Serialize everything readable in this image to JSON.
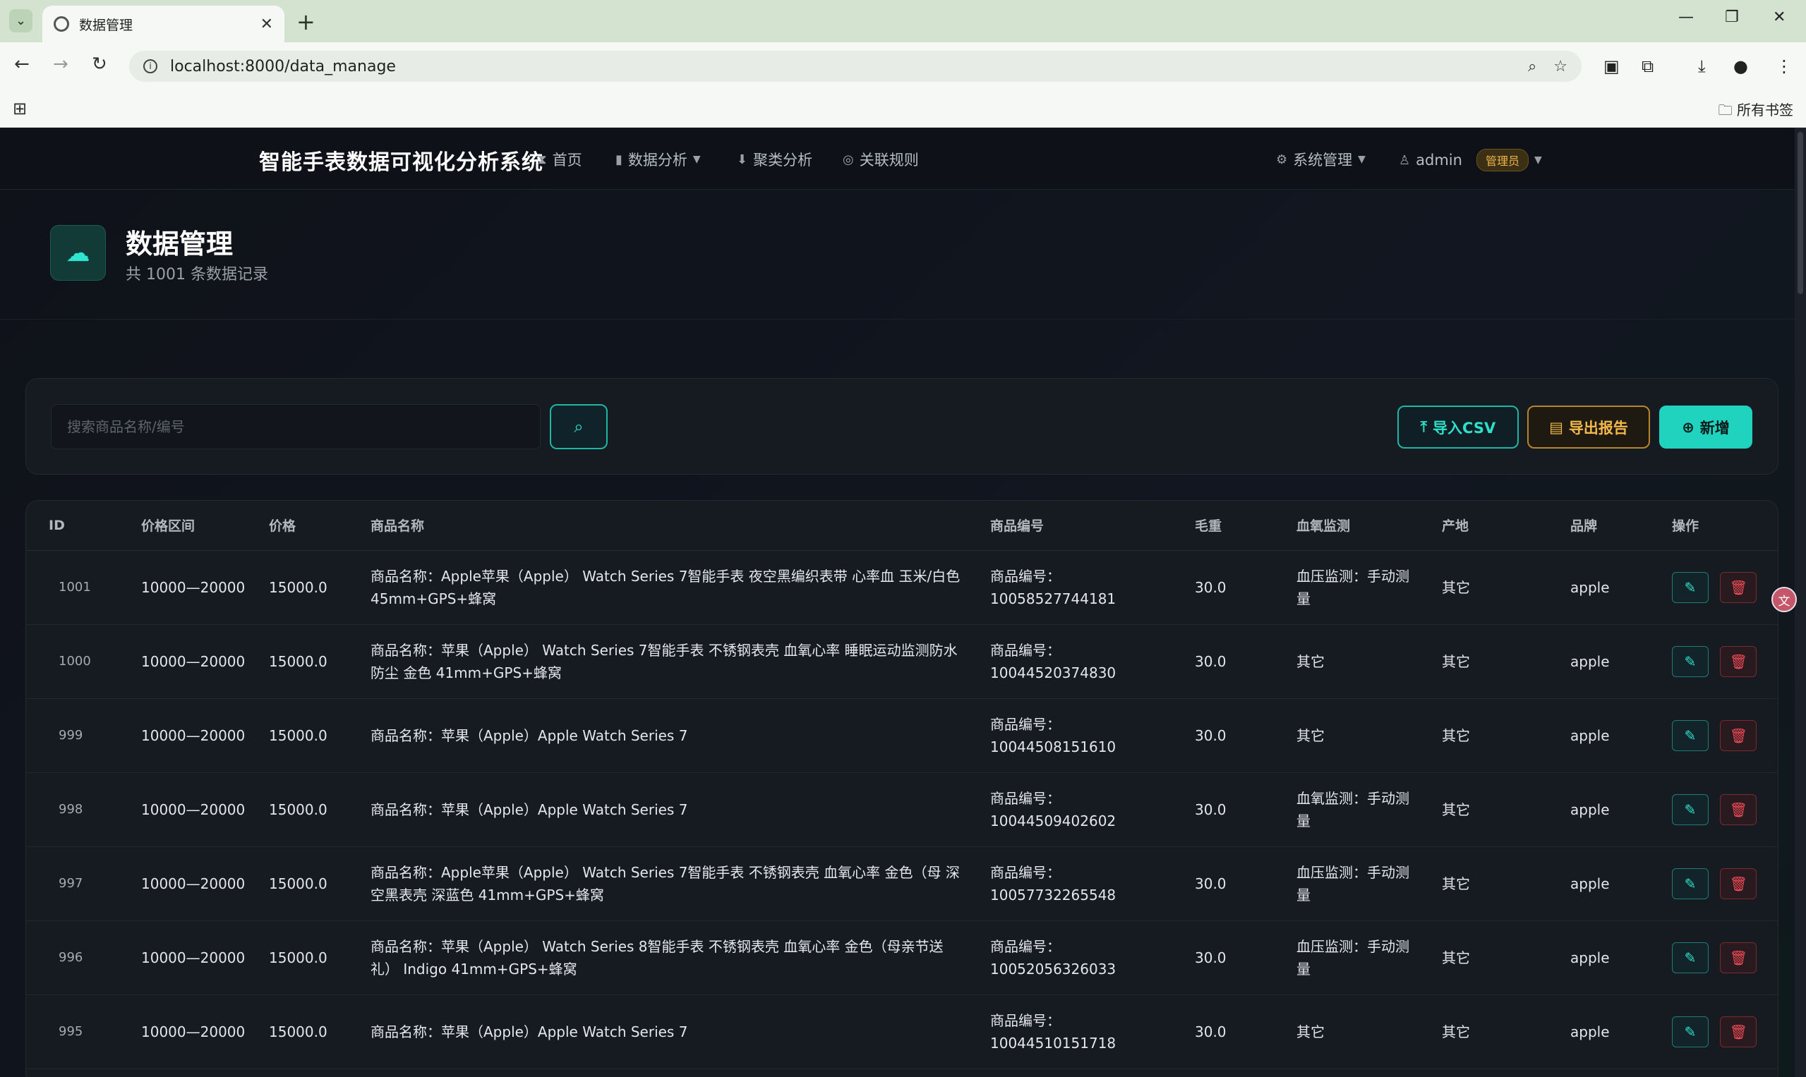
{
  "browser": {
    "tab_title": "数据管理",
    "url": "localhost:8000/data_manage",
    "bookmarks_label": "所有书签"
  },
  "nav": {
    "brand": "智能手表数据可视化分析系统",
    "home": "首页",
    "data_analysis": "数据分析",
    "cluster_analysis": "聚类分析",
    "association_rules": "关联规则",
    "system_management": "系统管理",
    "user": "admin",
    "role": "管理员"
  },
  "header": {
    "title": "数据管理",
    "subtitle": "共 1001 条数据记录"
  },
  "toolbar": {
    "search_placeholder": "搜索商品名称/编号",
    "import_label": "导入CSV",
    "export_label": "导出报告",
    "add_label": "新增"
  },
  "table": {
    "headers": [
      "ID",
      "价格区间",
      "价格",
      "商品名称",
      "商品编号",
      "毛重",
      "血氧监测",
      "产地",
      "品牌",
      "操作"
    ],
    "rows": [
      {
        "id": "1001",
        "range": "10000—20000",
        "price": "15000.0",
        "name": "商品名称：Apple苹果（Apple） Watch Series 7智能手表 夜空黑编织表带 心率血 玉米/白色 45mm+GPS+蜂窝",
        "code": "商品编号：10058527744181",
        "weight": "30.0",
        "oxygen": "血压监测：手动测量",
        "origin": "其它",
        "brand": "apple"
      },
      {
        "id": "1000",
        "range": "10000—20000",
        "price": "15000.0",
        "name": "商品名称：苹果（Apple） Watch Series 7智能手表 不锈钢表壳 血氧心率 睡眠运动监测防水防尘 金色 41mm+GPS+蜂窝",
        "code": "商品编号：10044520374830",
        "weight": "30.0",
        "oxygen": "其它",
        "origin": "其它",
        "brand": "apple"
      },
      {
        "id": "999",
        "range": "10000—20000",
        "price": "15000.0",
        "name": "商品名称：苹果（Apple）Apple Watch Series 7",
        "code": "商品编号：10044508151610",
        "weight": "30.0",
        "oxygen": "其它",
        "origin": "其它",
        "brand": "apple"
      },
      {
        "id": "998",
        "range": "10000—20000",
        "price": "15000.0",
        "name": "商品名称：苹果（Apple）Apple Watch Series 7",
        "code": "商品编号：10044509402602",
        "weight": "30.0",
        "oxygen": "血氧监测：手动测量",
        "origin": "其它",
        "brand": "apple"
      },
      {
        "id": "997",
        "range": "10000—20000",
        "price": "15000.0",
        "name": "商品名称：Apple苹果（Apple） Watch Series 7智能手表 不锈钢表壳 血氧心率 金色（母 深空黑表壳 深蓝色 41mm+GPS+蜂窝",
        "code": "商品编号：10057732265548",
        "weight": "30.0",
        "oxygen": "血压监测：手动测量",
        "origin": "其它",
        "brand": "apple"
      },
      {
        "id": "996",
        "range": "10000—20000",
        "price": "15000.0",
        "name": "商品名称：苹果（Apple） Watch Series 8智能手表 不锈钢表壳 血氧心率 金色（母亲节送礼） Indigo 41mm+GPS+蜂窝",
        "code": "商品编号：10052056326033",
        "weight": "30.0",
        "oxygen": "血压监测：手动测量",
        "origin": "其它",
        "brand": "apple"
      },
      {
        "id": "995",
        "range": "10000—20000",
        "price": "15000.0",
        "name": "商品名称：苹果（Apple）Apple Watch Series 7",
        "code": "商品编号：10044510151718",
        "weight": "30.0",
        "oxygen": "其它",
        "origin": "其它",
        "brand": "apple"
      }
    ]
  },
  "colors": {
    "accent": "#1fd3bf",
    "warning": "#f2b84b",
    "danger": "#ef4a55",
    "background": "#10131a"
  }
}
